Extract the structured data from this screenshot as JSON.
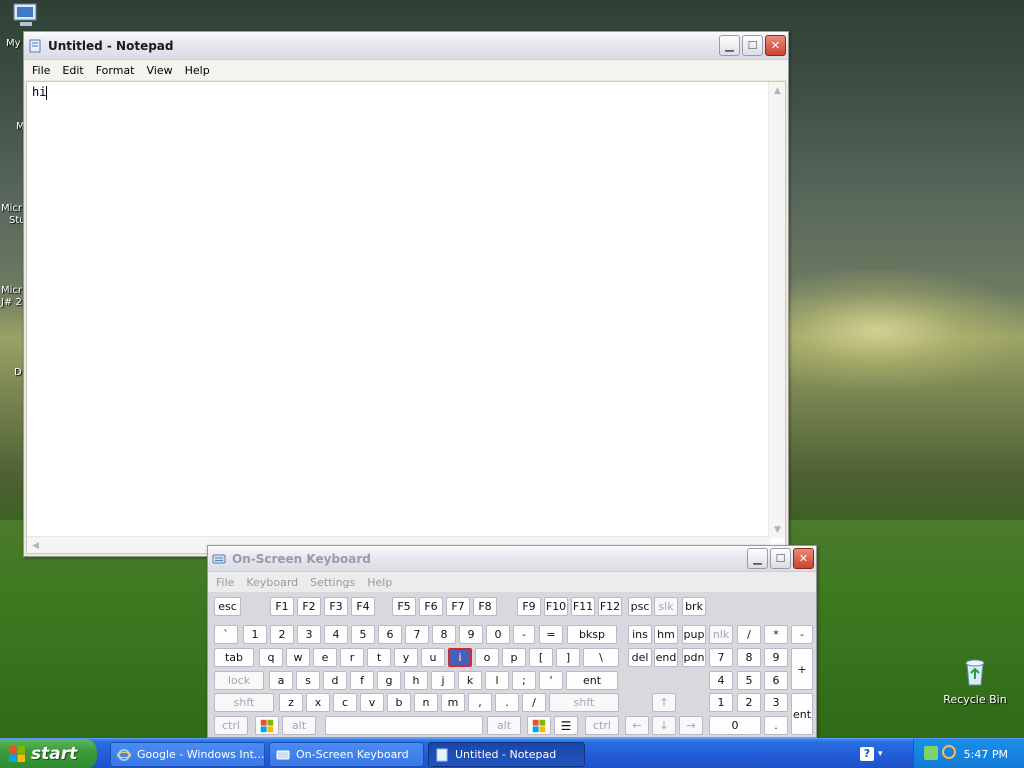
{
  "desktop": {
    "icons": [
      {
        "label": "My"
      },
      {
        "label": "Recycle Bin"
      }
    ],
    "fragments": [
      "M",
      "Micr",
      "Stu",
      "Micr",
      "J# 2",
      "D"
    ]
  },
  "notepad": {
    "title": "Untitled - Notepad",
    "menu": [
      "File",
      "Edit",
      "Format",
      "View",
      "Help"
    ],
    "content": "hi"
  },
  "osk": {
    "title": "On-Screen Keyboard",
    "menu": [
      "File",
      "Keyboard",
      "Settings",
      "Help"
    ],
    "rows": {
      "fn": [
        "esc",
        "F1",
        "F2",
        "F3",
        "F4",
        "F5",
        "F6",
        "F7",
        "F8",
        "F9",
        "F10",
        "F11",
        "F12",
        "psc",
        "slk",
        "brk"
      ],
      "num": [
        "`",
        "1",
        "2",
        "3",
        "4",
        "5",
        "6",
        "7",
        "8",
        "9",
        "0",
        "-",
        "=",
        "bksp",
        "ins",
        "hm",
        "pup",
        "nlk",
        "/",
        "*",
        "-"
      ],
      "top": [
        "tab",
        "q",
        "w",
        "e",
        "r",
        "t",
        "y",
        "u",
        "i",
        "o",
        "p",
        "[",
        "]",
        "\\",
        "del",
        "end",
        "pdn",
        "7",
        "8",
        "9",
        "+"
      ],
      "home": [
        "lock",
        "a",
        "s",
        "d",
        "f",
        "g",
        "h",
        "j",
        "k",
        "l",
        ";",
        "'",
        "ent",
        "4",
        "5",
        "6"
      ],
      "bottom": [
        "shft",
        "z",
        "x",
        "c",
        "v",
        "b",
        "n",
        "m",
        ",",
        ".",
        "/",
        "shft",
        "↑",
        "1",
        "2",
        "3",
        "ent"
      ],
      "space": [
        "ctrl",
        "alt",
        "alt",
        "ctrl",
        "←",
        "↓",
        "→",
        "0",
        "."
      ]
    },
    "highlighted_key": "i"
  },
  "taskbar": {
    "start_label": "start",
    "tasks": [
      {
        "label": "Google - Windows Int..."
      },
      {
        "label": "On-Screen Keyboard"
      },
      {
        "label": "Untitled - Notepad"
      }
    ],
    "clock": "5:47 PM"
  }
}
